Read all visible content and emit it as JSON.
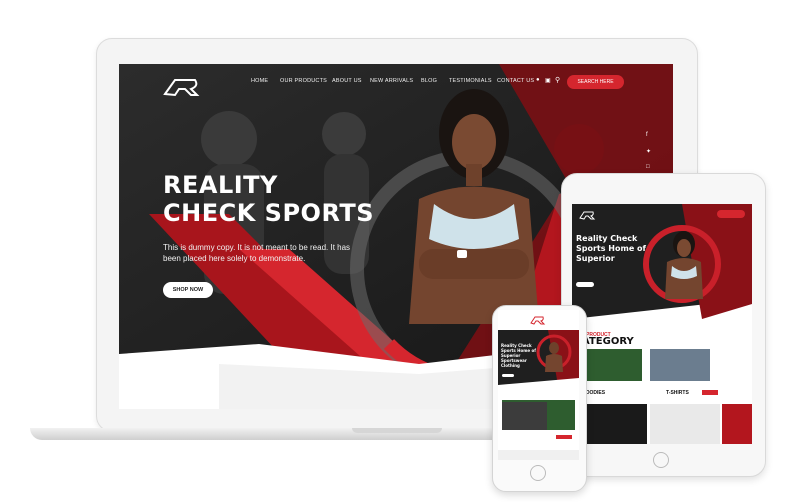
{
  "brand": {
    "logo_letter": "R"
  },
  "nav": {
    "items": [
      "HOME",
      "OUR PRODUCTS",
      "ABOUT US",
      "NEW ARRIVALS",
      "BLOG",
      "TESTIMONIALS",
      "CONTACT US"
    ],
    "search_label": "SEARCH HERE"
  },
  "hero": {
    "title_line1": "REALITY",
    "title_line2": "CHECK SPORTS",
    "body": "This is dummy copy. It is not meant to be read. It has been placed here solely to demonstrate.",
    "cta": "SHOP NOW"
  },
  "tablet": {
    "hero_title": "Reality Check Sports Home of Superior",
    "section_heading": "ATEGORY",
    "section_kicker": "PRODUCT",
    "card1": "HOODIES",
    "card2": "T-SHIRTS"
  },
  "phone": {
    "hero_title": "Reality Check Sports Home of Superior Sportswear Clothing"
  },
  "colors": {
    "accent": "#d5262e",
    "dark": "#1e1e1e"
  }
}
